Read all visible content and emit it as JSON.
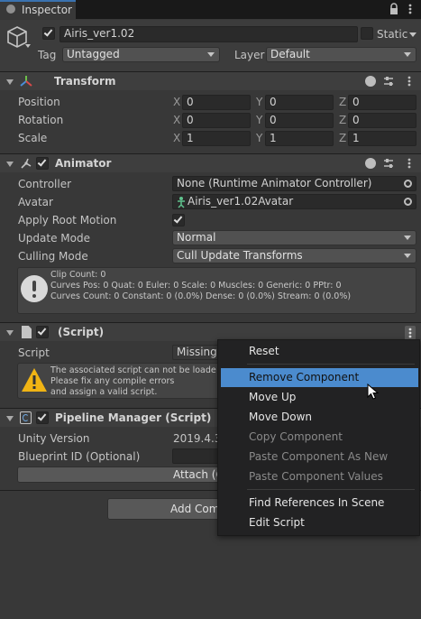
{
  "tab": {
    "title": "Inspector"
  },
  "object": {
    "name": "Airis_ver1.02",
    "static_label": "Static",
    "tag_label": "Tag",
    "tag_value": "Untagged",
    "layer_label": "Layer",
    "layer_value": "Default"
  },
  "transform": {
    "title": "Transform",
    "rows": [
      {
        "label": "Position",
        "x": "0",
        "y": "0",
        "z": "0"
      },
      {
        "label": "Rotation",
        "x": "0",
        "y": "0",
        "z": "0"
      },
      {
        "label": "Scale",
        "x": "1",
        "y": "1",
        "z": "1"
      }
    ],
    "axis": {
      "x": "X",
      "y": "Y",
      "z": "Z"
    }
  },
  "animator": {
    "title": "Animator",
    "controller_label": "Controller",
    "controller_value": "None (Runtime Animator Controller)",
    "avatar_label": "Avatar",
    "avatar_value": "Airis_ver1.02Avatar",
    "root_motion_label": "Apply Root Motion",
    "update_mode_label": "Update Mode",
    "update_mode_value": "Normal",
    "culling_mode_label": "Culling Mode",
    "culling_mode_value": "Cull Update Transforms",
    "info": [
      "Clip Count: 0",
      "Curves Pos: 0 Quat: 0 Euler: 0 Scale: 0 Muscles: 0 Generic: 0 PPtr: 0",
      "Curves Count: 0 Constant: 0 (0.0%) Dense: 0 (0.0%) Stream: 0 (0.0%)"
    ]
  },
  "missing_script": {
    "title": "(Script)",
    "script_label": "Script",
    "script_value": "Missing",
    "warning": [
      "The associated script can not be loade",
      "Please fix any compile errors",
      "and assign a valid script."
    ]
  },
  "pipeline": {
    "title": "Pipeline Manager (Script)",
    "unity_version_label": "Unity Version",
    "unity_version_value": "2019.4.3",
    "blueprint_label": "Blueprint ID (Optional)",
    "attach_label": "Attach (C"
  },
  "add_component_label": "Add Com",
  "context_menu": {
    "items": [
      {
        "label": "Reset",
        "enabled": true
      },
      {
        "label": "Remove Component",
        "enabled": true,
        "highlighted": true
      },
      {
        "label": "Move Up",
        "enabled": true
      },
      {
        "label": "Move Down",
        "enabled": true
      },
      {
        "label": "Copy Component",
        "enabled": false
      },
      {
        "label": "Paste Component As New",
        "enabled": false
      },
      {
        "label": "Paste Component Values",
        "enabled": false
      },
      {
        "label": "Find References In Scene",
        "enabled": true
      },
      {
        "label": "Edit Script",
        "enabled": true
      }
    ]
  },
  "colors": {
    "background": "#383838",
    "header": "#3e3e3e",
    "highlight": "#4b8bce",
    "menu_bg": "#222223"
  }
}
